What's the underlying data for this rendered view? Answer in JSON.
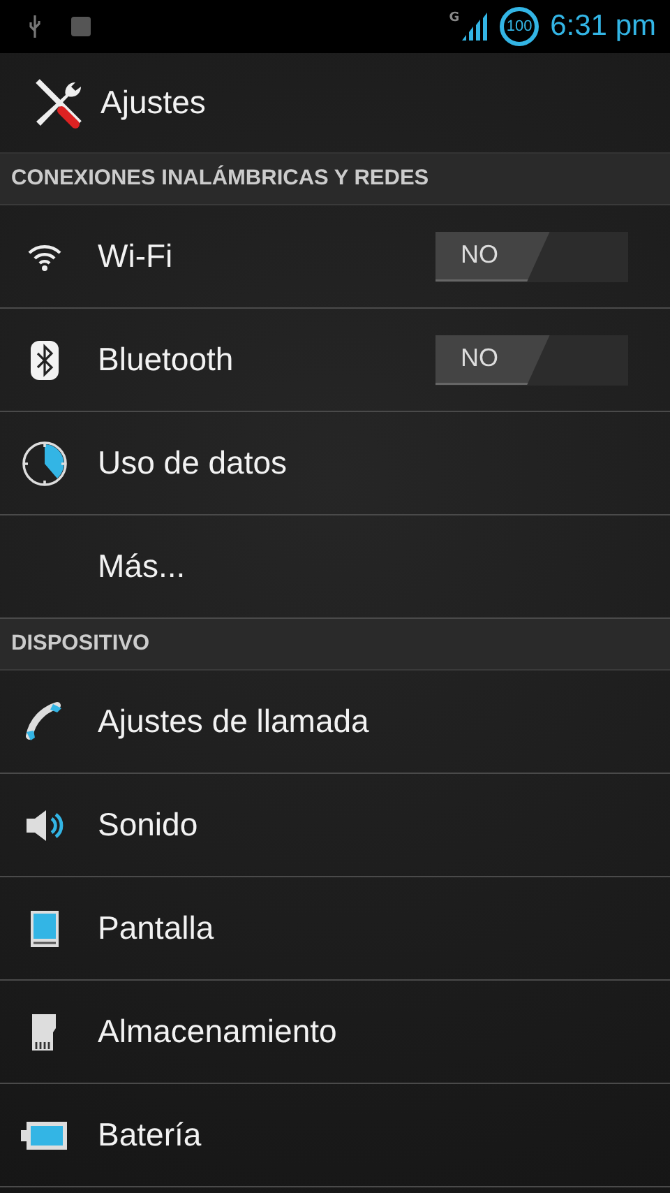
{
  "status_bar": {
    "network_type": "G",
    "battery": "100",
    "time": "6:31 pm"
  },
  "action_bar": {
    "title": "Ajustes"
  },
  "sections": [
    {
      "header": "CONEXIONES INALÁMBRICAS Y REDES",
      "items": [
        {
          "kind": "switch",
          "label": "Wi-Fi",
          "on": false,
          "switch_text": "NO"
        },
        {
          "kind": "switch",
          "label": "Bluetooth",
          "on": false,
          "switch_text": "NO"
        },
        {
          "kind": "plain",
          "label": "Uso de datos"
        },
        {
          "kind": "plain",
          "label": "Más..."
        }
      ]
    },
    {
      "header": "DISPOSITIVO",
      "items": [
        {
          "kind": "plain",
          "label": "Ajustes de llamada"
        },
        {
          "kind": "plain",
          "label": "Sonido"
        },
        {
          "kind": "plain",
          "label": "Pantalla"
        },
        {
          "kind": "plain",
          "label": "Almacenamiento"
        },
        {
          "kind": "plain",
          "label": "Batería"
        }
      ]
    }
  ]
}
